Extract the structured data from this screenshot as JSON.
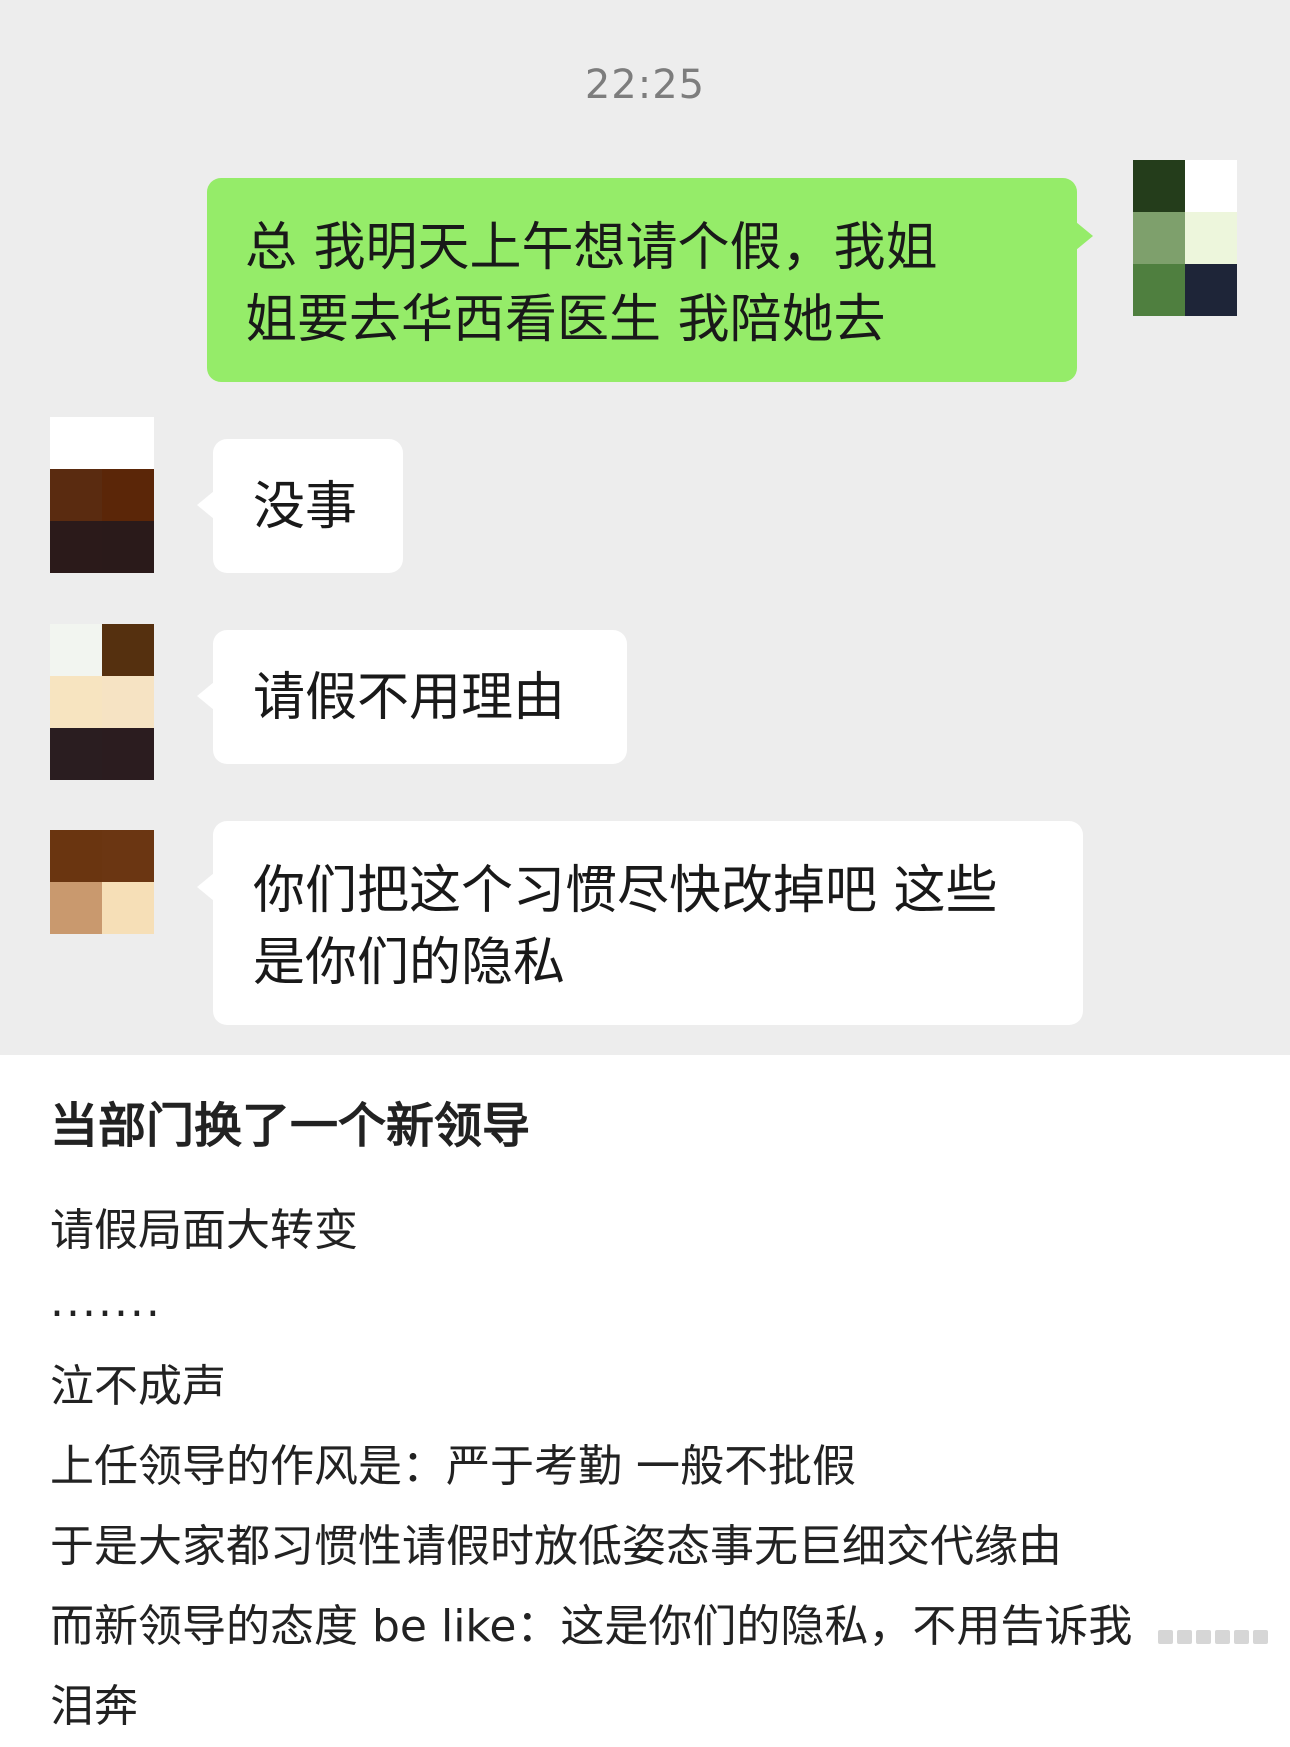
{
  "chat": {
    "time": "22:25",
    "messages": [
      {
        "side": "right",
        "lines": [
          "总 我明天上午想请个假，我姐",
          "姐要去华西看医生 我陪她去"
        ]
      },
      {
        "side": "left",
        "lines": [
          "没事"
        ]
      },
      {
        "side": "left",
        "lines": [
          "请假不用理由"
        ]
      },
      {
        "side": "left",
        "lines": [
          "你们把这个习惯尽快改掉吧 这些",
          "是你们的隐私"
        ]
      }
    ]
  },
  "post": {
    "title": "当部门换了一个新领导",
    "lines": [
      "请假局面大转变",
      ".......",
      "泣不成声",
      "上任领导的作风是：严于考勤 一般不批假",
      "于是大家都习惯性请假时放低姿态事无巨细交代缘由",
      "而新领导的态度 be like：这是你们的隐私，不用告诉我",
      "泪奔"
    ]
  },
  "colors": {
    "chat_background": "#ededed",
    "sent_bubble": "#95ec69",
    "received_bubble": "#ffffff",
    "time_text": "#7d7d7d"
  }
}
